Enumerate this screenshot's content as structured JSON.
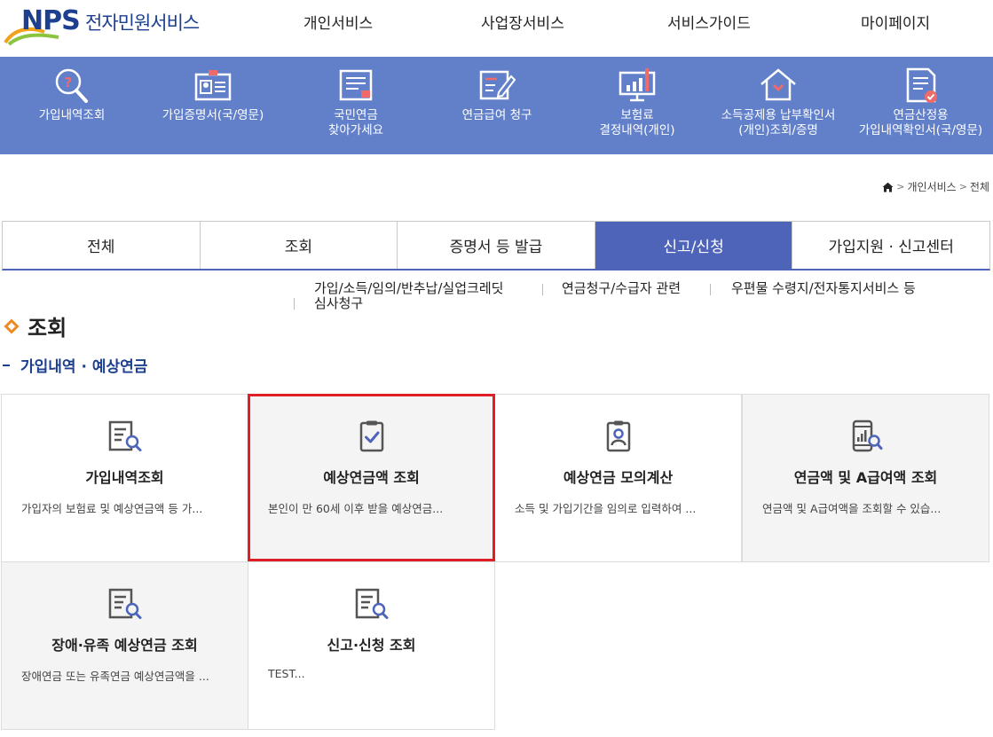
{
  "header": {
    "logo_text": "NPS",
    "logo_title": "전자민원서비스",
    "nav": [
      "개인서비스",
      "사업장서비스",
      "서비스가이드",
      "마이페이지"
    ]
  },
  "quick_menu": [
    {
      "label": "가입내역조회",
      "icon": "magnifier-question-icon"
    },
    {
      "label": "가입증명서(국/영문)",
      "icon": "id-card-icon"
    },
    {
      "label": "국민연금\n찾아가세요",
      "icon": "document-list-icon"
    },
    {
      "label": "연금급여 청구",
      "icon": "edit-form-icon"
    },
    {
      "label": "보험료\n결정내역(개인)",
      "icon": "monitor-chart-icon"
    },
    {
      "label": "소득공제용 납부확인서\n(개인)조회/증명",
      "icon": "house-icon"
    },
    {
      "label": "연금산정용\n가입내역확인서(국/영문)",
      "icon": "document-check-icon"
    }
  ],
  "breadcrumb": [
    "개인서비스",
    "전체"
  ],
  "tabs": [
    "전체",
    "조회",
    "증명서 등 발급",
    "신고/신청",
    "가입지원 · 신고센터"
  ],
  "active_tab": "신고/신청",
  "subnav": [
    "가입/소득/임의/반추납/실업크레딧",
    "연금청구/수급자 관련",
    "우편물 수령지/전자통지서비스 등",
    "심사청구"
  ],
  "section": {
    "title": "조회",
    "subtitle": "가입내역 · 예상연금"
  },
  "cards": [
    {
      "title": "가입내역조회",
      "desc": "가입자의 보험료 및 예상연금액 등 가...",
      "icon": "document-search-icon"
    },
    {
      "title": "예상연금액 조회",
      "desc": "본인이 만 60세 이후 받을 예상연금...",
      "icon": "clipboard-check-icon"
    },
    {
      "title": "예상연금 모의계산",
      "desc": "소득 및 가입기간을 임의로 입력하여 ...",
      "icon": "person-badge-icon"
    },
    {
      "title": "연금액 및 A급여액 조회",
      "desc": "연금액 및 A급여액을 조회할 수 있습...",
      "icon": "phone-chart-icon"
    },
    {
      "title": "장애·유족 예상연금 조회",
      "desc": "장애연금 또는 유족연금 예상연금액을 ...",
      "icon": "document-search-icon"
    },
    {
      "title": "신고·신청 조회",
      "desc": "TEST...",
      "icon": "document-search-icon"
    }
  ],
  "colors": {
    "brand_blue": "#1d3f8f",
    "band": "#6280c9",
    "tab_active": "#4d64b8",
    "highlight": "#e01e25",
    "accent_orange": "#ef8a21"
  }
}
